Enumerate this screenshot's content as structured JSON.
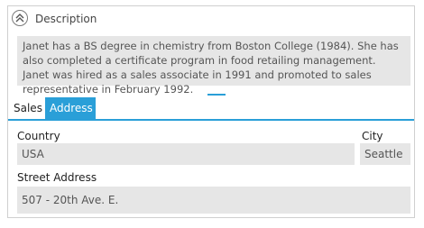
{
  "description": {
    "title": "Description",
    "text": "Janet has a BS degree in chemistry from Boston College (1984).  She has also completed a certificate program in food retailing management.  Janet was hired as a sales associate in 1991 and promoted to sales representative in February 1992."
  },
  "tabs": {
    "sales": "Sales",
    "address": "Address",
    "active": "Address"
  },
  "address": {
    "country_label": "Country",
    "country_value": "USA",
    "city_label": "City",
    "city_value": "Seattle",
    "street_label": "Street Address",
    "street_value": "507 - 20th Ave. E."
  },
  "colors": {
    "accent": "#2a9fd8",
    "field_bg": "#e6e6e6"
  },
  "icons": {
    "collapse": "double-chevron-up-icon"
  }
}
